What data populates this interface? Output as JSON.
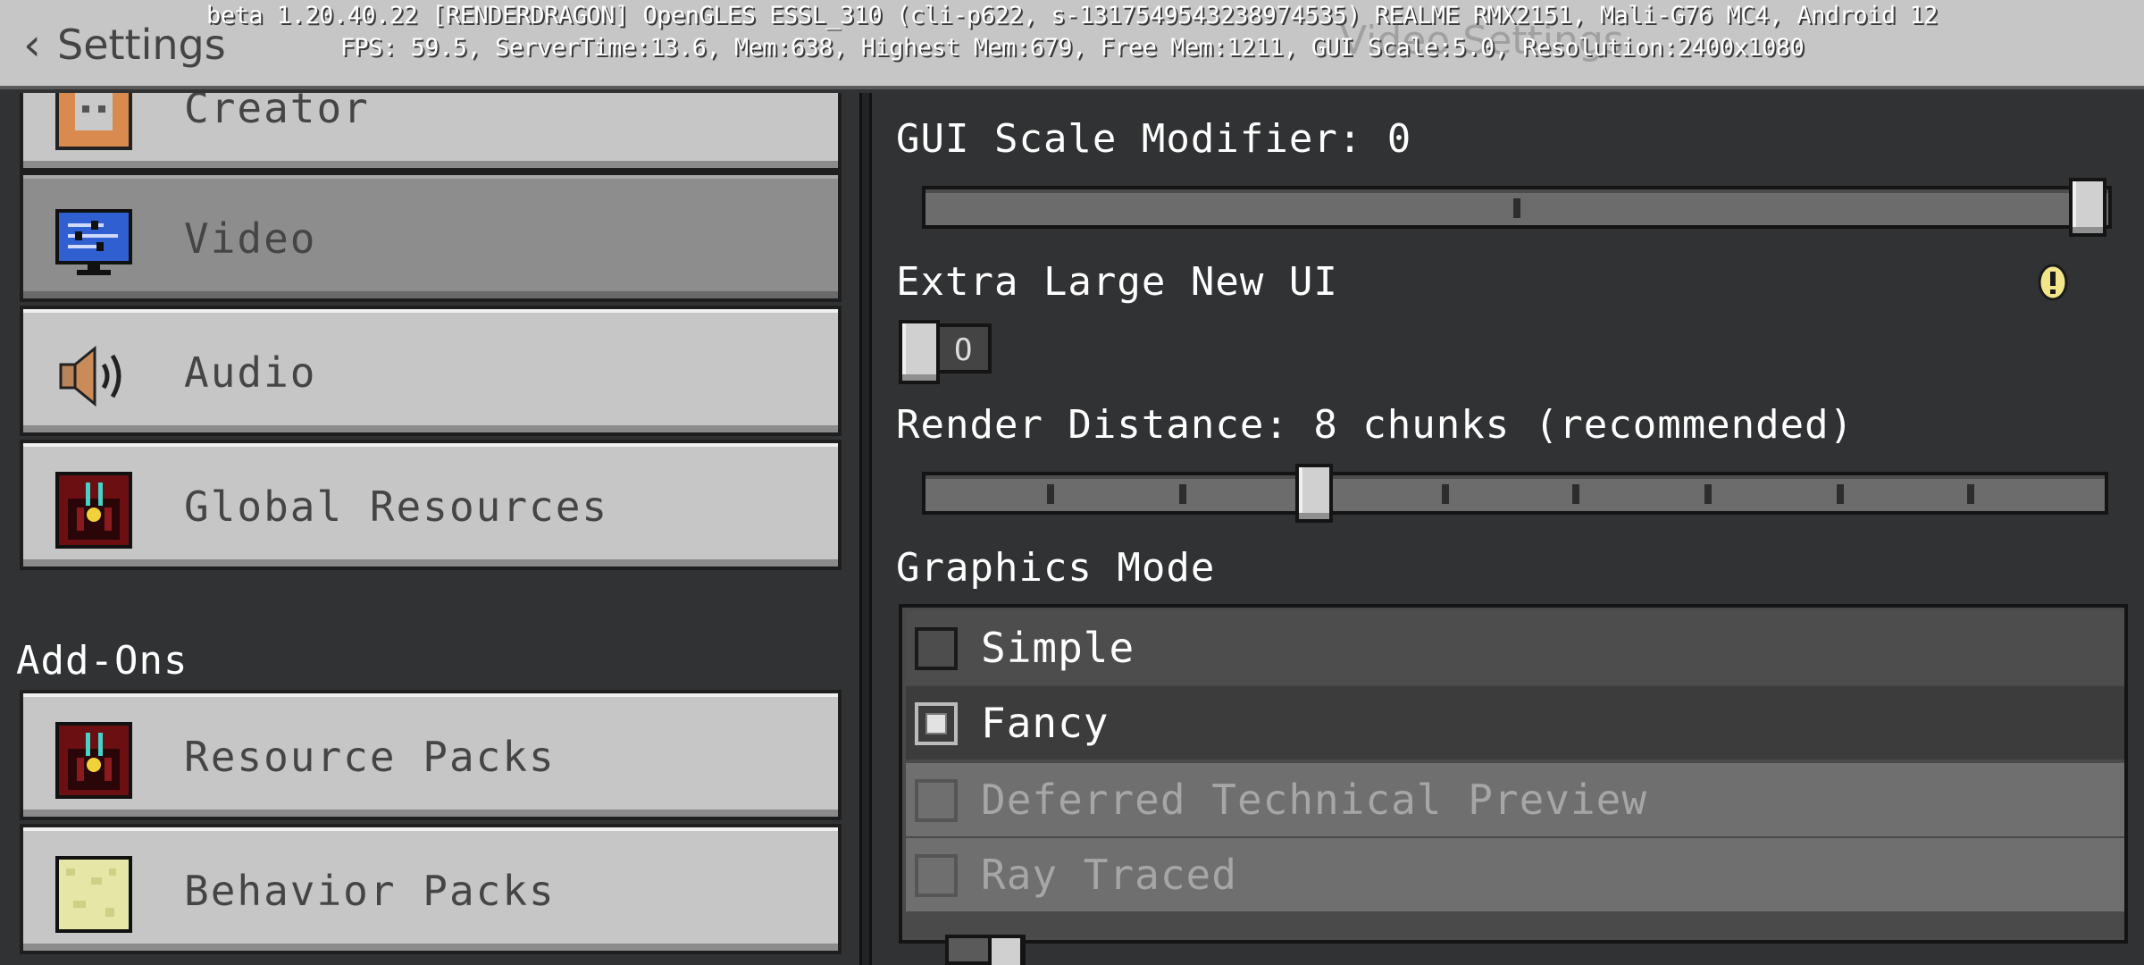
{
  "header": {
    "back_label": "Settings",
    "page_title": "Video Settings",
    "debug_line1": "beta 1.20.40.22 [RENDERDRAGON] OpenGLES ESSL_310 (cli-p622, s-1317549543238974535) REALME RMX2151, Mali-G76 MC4, Android 12",
    "debug_line2": "FPS: 59.5, ServerTime:13.6, Mem:638, Highest Mem:679, Free Mem:1211, GUI Scale:5.0, Resolution:2400x1080"
  },
  "sidebar": {
    "items": [
      {
        "label": "Creator",
        "icon": "creator-icon"
      },
      {
        "label": "Video",
        "icon": "monitor-icon",
        "selected": true
      },
      {
        "label": "Audio",
        "icon": "speaker-icon"
      },
      {
        "label": "Global Resources",
        "icon": "resource-pack-icon"
      }
    ],
    "section_heading": "Add-Ons",
    "addon_items": [
      {
        "label": "Resource Packs",
        "icon": "resource-pack-icon"
      },
      {
        "label": "Behavior Packs",
        "icon": "behavior-pack-icon"
      }
    ]
  },
  "options": {
    "gui_scale_label": "GUI Scale Modifier: 0",
    "gui_scale_value": 1.0,
    "extra_large_ui_label": "Extra Large New UI",
    "extra_large_ui_state": "O",
    "render_distance_label": "Render Distance: 8 chunks (recommended)",
    "graphics_mode_label": "Graphics Mode",
    "graphics_modes": [
      {
        "label": "Simple",
        "checked": false,
        "enabled": true
      },
      {
        "label": "Fancy",
        "checked": true,
        "enabled": true
      },
      {
        "label": "Deferred Technical Preview",
        "checked": false,
        "enabled": false
      },
      {
        "label": "Ray Traced",
        "checked": false,
        "enabled": false
      }
    ]
  },
  "colors": {
    "background": "#313233",
    "panel_button": "#c6c6c6",
    "selected_button": "#8d8d8d",
    "highlight_row": "#3c3c3c",
    "info_icon": "#f3e58a"
  }
}
